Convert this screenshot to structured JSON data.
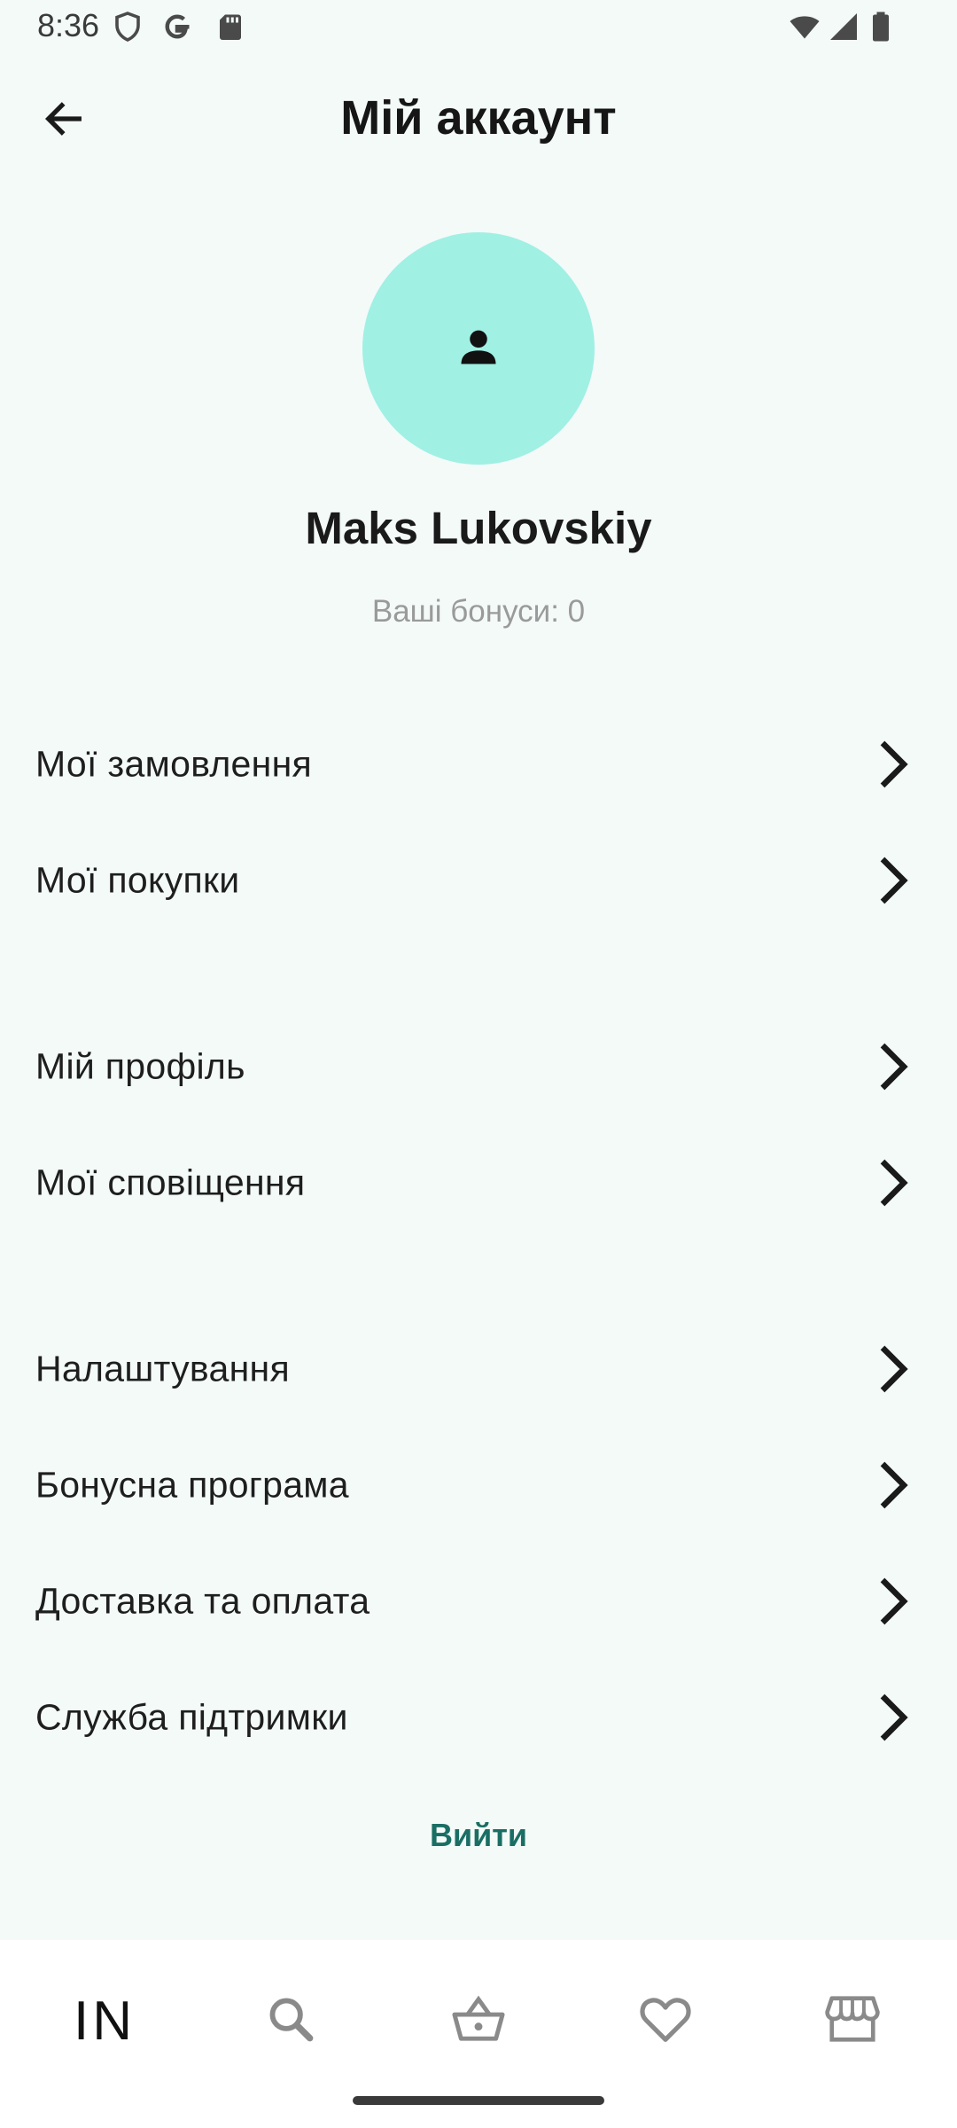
{
  "status_bar": {
    "time": "8:36",
    "icons_left": [
      "shield-icon",
      "google-icon",
      "sd-card-icon"
    ],
    "icons_right": [
      "wifi-icon",
      "signal-icon",
      "battery-icon"
    ]
  },
  "header": {
    "title": "Мій аккаунт",
    "back_icon": "arrow-left-icon"
  },
  "profile": {
    "avatar_icon": "person-icon",
    "avatar_color": "#a0f0e4",
    "name": "Maks Lukovskiy",
    "bonus_label": "Ваші бонуси: 0"
  },
  "menu": {
    "group1": [
      {
        "label": "Мої замовлення"
      },
      {
        "label": "Мої покупки"
      }
    ],
    "group2": [
      {
        "label": "Мій профіль"
      },
      {
        "label": "Мої сповіщення"
      }
    ],
    "group3": [
      {
        "label": "Налаштування"
      },
      {
        "label": "Бонусна програма"
      },
      {
        "label": "Доставка та оплата"
      },
      {
        "label": "Служба підтримки"
      }
    ]
  },
  "logout": {
    "label": "Вийти",
    "color": "#1a6e63"
  },
  "bottom_nav": {
    "items": [
      {
        "label": "IN",
        "icon": "brand-logo"
      },
      {
        "icon": "search-icon"
      },
      {
        "icon": "basket-icon"
      },
      {
        "icon": "heart-icon"
      },
      {
        "icon": "store-icon"
      }
    ]
  },
  "colors": {
    "background": "#f3faf8",
    "nav_background": "#ffffff",
    "accent": "#1a6e63"
  }
}
